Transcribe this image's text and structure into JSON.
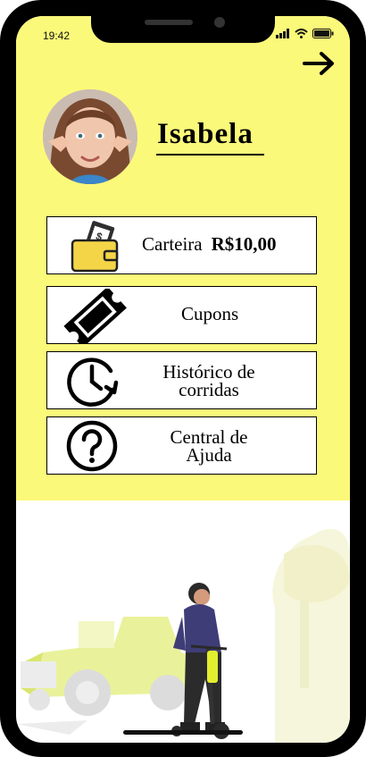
{
  "status_bar": {
    "time": "19:42"
  },
  "profile": {
    "name": "Isabela"
  },
  "menu": {
    "wallet": {
      "label": "Carteira",
      "amount": "R$10,00"
    },
    "coupons": {
      "label": "Cupons"
    },
    "history": {
      "line1": "Histórico de",
      "line2": "corridas"
    },
    "help": {
      "line1": "Central de",
      "line2": "Ajuda"
    }
  },
  "colors": {
    "background_yellow": "#fbf97a",
    "wallet_yellow": "#f5d548"
  },
  "icons": [
    "next-arrow-icon",
    "wallet-icon",
    "ticket-icon",
    "history-clock-icon",
    "help-question-icon"
  ]
}
